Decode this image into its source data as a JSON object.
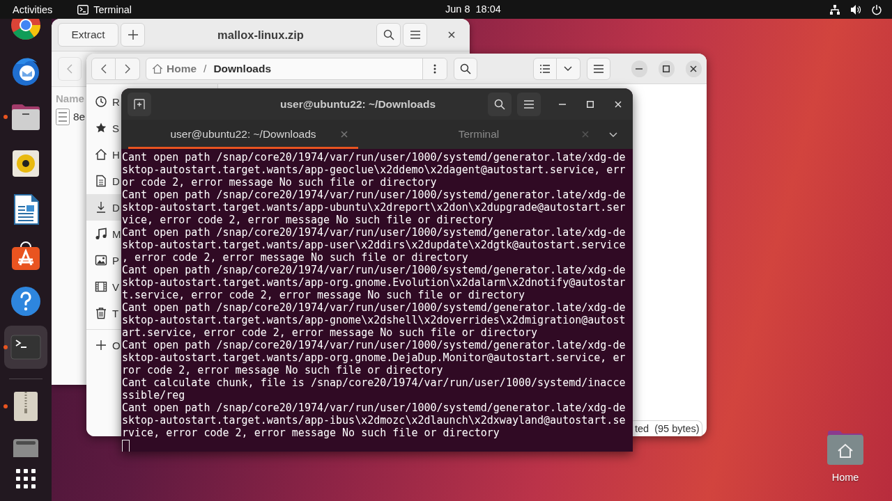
{
  "top_bar": {
    "activities": "Activities",
    "app_name": "Terminal",
    "clock": "Jun 8  18:04"
  },
  "dock": {
    "items": [
      {
        "kind": "browser",
        "running": false,
        "selected": false
      },
      {
        "kind": "mail",
        "running": false,
        "selected": false
      },
      {
        "kind": "files",
        "running": true,
        "selected": false
      },
      {
        "kind": "music",
        "running": false,
        "selected": false
      },
      {
        "kind": "writer",
        "running": false,
        "selected": false
      },
      {
        "kind": "store",
        "running": false,
        "selected": false
      },
      {
        "kind": "help",
        "running": false,
        "selected": false
      },
      {
        "kind": "terminal",
        "running": true,
        "selected": true
      },
      {
        "kind": "separator"
      },
      {
        "kind": "archive",
        "running": true,
        "selected": false
      },
      {
        "kind": "drive",
        "running": false,
        "selected": false
      },
      {
        "kind": "apps",
        "running": false,
        "selected": false
      }
    ]
  },
  "archive_window": {
    "extract_button": "Extract",
    "title": "mallox-linux.zip",
    "column_1": "Name",
    "files": [
      {
        "name": "8e"
      }
    ]
  },
  "files_window": {
    "path": [
      "Home",
      "Downloads"
    ],
    "path_separator": "/",
    "sidebar": [
      {
        "kind": "recent",
        "label": "R",
        "selected": false
      },
      {
        "kind": "starred",
        "label": "S",
        "selected": false
      },
      {
        "kind": "home",
        "label": "H",
        "selected": false
      },
      {
        "kind": "documents",
        "label": "D",
        "selected": false
      },
      {
        "kind": "downloads",
        "label": "D",
        "selected": true
      },
      {
        "kind": "music",
        "label": "M",
        "selected": false
      },
      {
        "kind": "pictures",
        "label": "P",
        "selected": false
      },
      {
        "kind": "videos",
        "label": "V",
        "selected": false
      },
      {
        "kind": "trash",
        "label": "T",
        "selected": false
      },
      {
        "kind": "other",
        "label": "O",
        "selected": false
      }
    ],
    "status": "ted  (95 bytes)"
  },
  "terminal": {
    "title": "user@ubuntu22: ~/Downloads",
    "tabs": [
      {
        "label": "user@ubuntu22: ~/Downloads",
        "selected": true
      },
      {
        "label": "Terminal",
        "selected": false
      }
    ],
    "lines": [
      "Cant open path /snap/core20/1974/var/run/user/1000/systemd/generator.late/xdg-de",
      "sktop-autostart.target.wants/app-geoclue\\x2ddemo\\x2dagent@autostart.service, err",
      "or code 2, error message No such file or directory",
      "Cant open path /snap/core20/1974/var/run/user/1000/systemd/generator.late/xdg-de",
      "sktop-autostart.target.wants/app-ubuntu\\x2dreport\\x2don\\x2dupgrade@autostart.ser",
      "vice, error code 2, error message No such file or directory",
      "Cant open path /snap/core20/1974/var/run/user/1000/systemd/generator.late/xdg-de",
      "sktop-autostart.target.wants/app-user\\x2ddirs\\x2dupdate\\x2dgtk@autostart.service",
      ", error code 2, error message No such file or directory",
      "Cant open path /snap/core20/1974/var/run/user/1000/systemd/generator.late/xdg-de",
      "sktop-autostart.target.wants/app-org.gnome.Evolution\\x2dalarm\\x2dnotify@autostar",
      "t.service, error code 2, error message No such file or directory",
      "Cant open path /snap/core20/1974/var/run/user/1000/systemd/generator.late/xdg-de",
      "sktop-autostart.target.wants/app-gnome\\x2dshell\\x2doverrides\\x2dmigration@autost",
      "art.service, error code 2, error message No such file or directory",
      "Cant open path /snap/core20/1974/var/run/user/1000/systemd/generator.late/xdg-de",
      "sktop-autostart.target.wants/app-org.gnome.DejaDup.Monitor@autostart.service, er",
      "ror code 2, error message No such file or directory",
      "Cant calculate chunk, file is /snap/core20/1974/var/run/user/1000/systemd/inacce",
      "ssible/reg",
      "Cant open path /snap/core20/1974/var/run/user/1000/systemd/generator.late/xdg-de",
      "sktop-autostart.target.wants/app-ibus\\x2dmozc\\x2dlaunch\\x2dxwayland@autostart.se",
      "rvice, error code 2, error message No such file or directory"
    ]
  },
  "desktop_icons": [
    {
      "label": "Home"
    }
  ]
}
